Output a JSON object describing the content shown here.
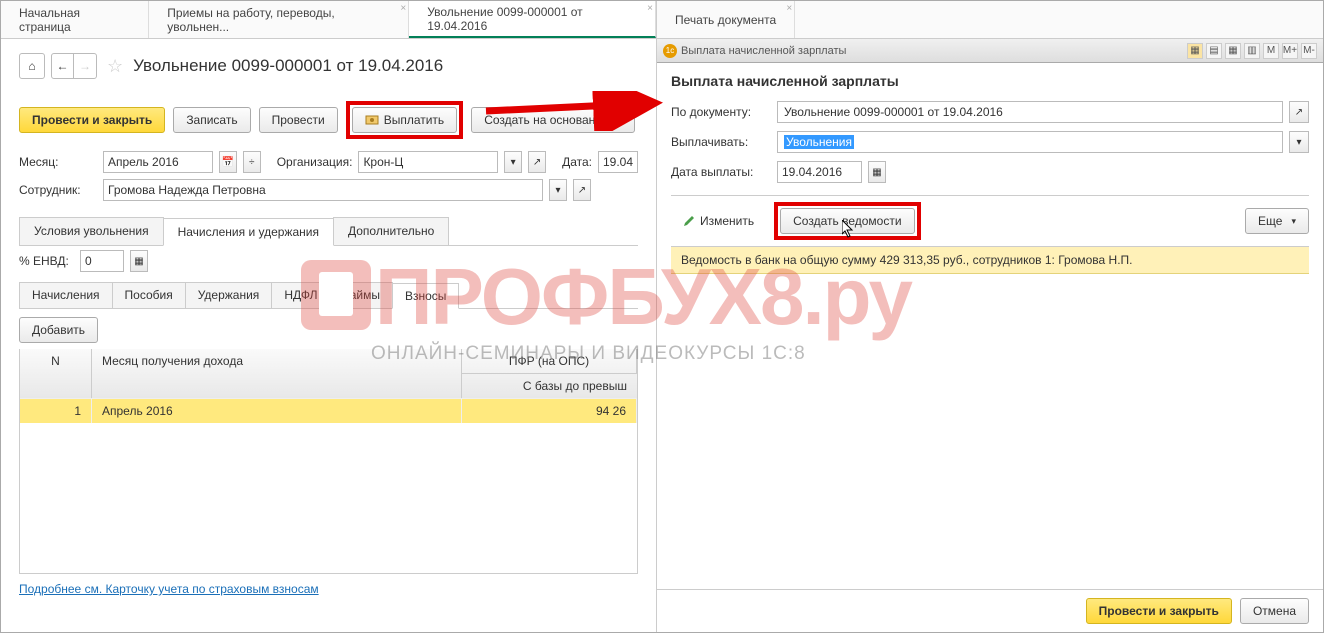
{
  "tabs": {
    "t0": "Начальная страница",
    "t1": "Приемы на работу, переводы, увольнен...",
    "t2": "Увольнение 0099-000001 от 19.04.2016",
    "t3": "Печать документа"
  },
  "doc": {
    "title": "Увольнение 0099-000001 от 19.04.2016"
  },
  "toolbar": {
    "post_close": "Провести и закрыть",
    "save": "Записать",
    "post": "Провести",
    "pay": "Выплатить",
    "create_based": "Создать на основании"
  },
  "form": {
    "month_label": "Месяц:",
    "month_value": "Апрель 2016",
    "org_label": "Организация:",
    "org_value": "Крон-Ц",
    "date_label": "Дата:",
    "date_value": "19.04",
    "employee_label": "Сотрудник:",
    "employee_value": "Громова Надежда Петровна",
    "envd_label": "% ЕНВД:",
    "envd_value": "0"
  },
  "subtabs": {
    "conditions": "Условия увольнения",
    "accruals": "Начисления и удержания",
    "additional": "Дополнительно"
  },
  "innertabs": {
    "accruals": "Начисления",
    "benefits": "Пособия",
    "deductions": "Удержания",
    "ndfl": "НДФЛ",
    "loans": "Займы",
    "contributions": "Взносы"
  },
  "buttons": {
    "add": "Добавить"
  },
  "table": {
    "col_n": "N",
    "col_month": "Месяц получения дохода",
    "col_pfr": "ПФР (на ОПС)",
    "col_base": "С базы до превыш",
    "row1_n": "1",
    "row1_month": "Апрель 2016",
    "row1_val": "94 26"
  },
  "links": {
    "card": "Подробнее см. Карточку учета по страховым взносам"
  },
  "right": {
    "window_title": "Выплата начисленной зарплаты",
    "heading": "Выплата начисленной зарплаты",
    "by_doc_label": "По документу:",
    "by_doc_value": "Увольнение 0099-000001 от 19.04.2016",
    "pay_label": "Выплачивать:",
    "pay_value": "Увольнения",
    "date_label": "Дата выплаты:",
    "date_value": "19.04.2016",
    "edit": "Изменить",
    "create_statements": "Создать ведомости",
    "more": "Еще",
    "strip": "Ведомость в банк на общую сумму 429 313,35 руб., сотрудников 1: Громова Н.П.",
    "post_close": "Провести и закрыть",
    "cancel": "Отмена",
    "tools": {
      "m": "M",
      "mp": "M+",
      "mm": "M-"
    }
  },
  "watermark": {
    "main": "ПРОФБУХ8.ру",
    "sub": "ОНЛАЙН-СЕМИНАРЫ И ВИДЕОКУРСЫ 1С:8"
  }
}
